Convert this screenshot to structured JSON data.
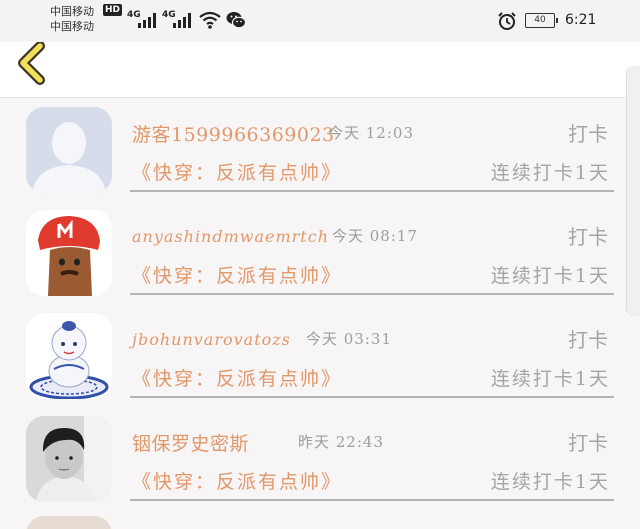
{
  "status_bar": {
    "carrier_1": "中国移动",
    "carrier_2": "中国移动",
    "hd_badge": "HD",
    "network_1": "4G",
    "network_2": "4G",
    "battery": "40",
    "time": "6:21"
  },
  "nav": {
    "back_icon": "chevron-left-icon"
  },
  "checkins": [
    {
      "name": "游客1599966369023",
      "time": "今天 12:03",
      "action": "打卡",
      "book": "《快穿：反派有点帅》",
      "streak": "连续打卡1天",
      "avatar": "default-person-avatar"
    },
    {
      "name": "anyashindmwaemrtch",
      "time": "今天 08:17",
      "action": "打卡",
      "book": "《快穿：反派有点帅》",
      "streak": "连续打卡1天",
      "avatar": "red-cap-character-avatar"
    },
    {
      "name": "jbohunvarovatozs",
      "time": "今天 03:31",
      "action": "打卡",
      "book": "《快穿：反派有点帅》",
      "streak": "连续打卡1天",
      "avatar": "porcelain-figure-avatar"
    },
    {
      "name": "铟保罗史密斯",
      "time": "昨天 22:43",
      "action": "打卡",
      "book": "《快穿：反派有点帅》",
      "streak": "连续打卡1天",
      "avatar": "boy-photo-avatar"
    }
  ],
  "colors": {
    "accent": "#e2986a",
    "muted": "#a5a5a5",
    "nav_icon": "#f2e05a"
  }
}
